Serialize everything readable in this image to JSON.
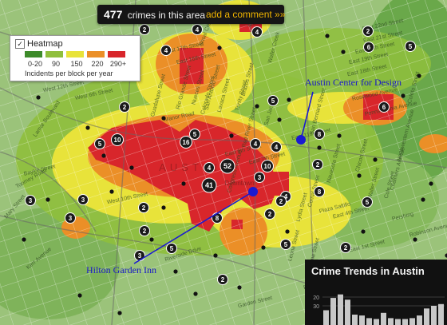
{
  "top_bar": {
    "count": "477",
    "count_label": "crimes in this area",
    "link": "add a comment »»"
  },
  "legend": {
    "checkbox_mark": "✓",
    "title": "Heatmap",
    "bins": [
      {
        "label": "0-20",
        "color": "#3d8b2a"
      },
      {
        "label": "90",
        "color": "#8fbf3c"
      },
      {
        "label": "150",
        "color": "#e8e33a"
      },
      {
        "label": "220",
        "color": "#eb8f27"
      },
      {
        "label": "290+",
        "color": "#d8262b"
      }
    ],
    "footnote": "Incidents per block per year"
  },
  "places": {
    "austin_center": "Austin Center for Design",
    "hilton": "Hilton Garden Inn",
    "city_label": "AUSTIN",
    "downtown": "Downtown"
  },
  "streets": [
    "East 22nd Street",
    "East 21st Street",
    "East 20th Street",
    "East 19th Street",
    "East 18th Street",
    "East 16th Street",
    "West 17th Street",
    "Manor Road",
    "Rosewood Avenue",
    "Pennsylvania Avenue",
    "East 11th Street",
    "East 6th Street",
    "West 6th Street",
    "Lamar Boulevard",
    "Guadalupe Street",
    "Colorado Street",
    "Congress Avenue",
    "Red River Street",
    "East 7th Street",
    "Navasota Street",
    "Chicon Street",
    "Comal Street",
    "East 4th Street",
    "Pershing",
    "Plaza Saltillo",
    "East 1st Street",
    "Garden Street",
    "Riverside Drive",
    "Rio Grande Street",
    "Nueces Street",
    "San Antonio Street",
    "Lavaca Street",
    "Trinity Street",
    "San Jacinto",
    "Brazos Street",
    "Waller Street",
    "Lydia Street",
    "Chalmers Avenue",
    "Northwestern Avenue",
    "Harvey Street",
    "Leona Street",
    "Salina Street",
    "Cole Street",
    "Coleto Street",
    "San Bernard Street",
    "Robinson Avenue",
    "Waller Creek",
    "Shoal Creek",
    "Kerr Avenue",
    "Mary Street",
    "Enfield Road",
    "Baylor Street",
    "Toomey Road",
    "Canterbury Street",
    "West 12th Street",
    "West 10th Street",
    "West Avenue",
    "East Cesar Chavez"
  ],
  "cluster_counts": [
    "10",
    "16",
    "52",
    "41",
    "10",
    "8",
    "4",
    "4",
    "4",
    "4",
    "4",
    "4",
    "4",
    "5",
    "5",
    "5",
    "5",
    "5",
    "5",
    "2",
    "2",
    "2",
    "2",
    "2",
    "2",
    "2",
    "2",
    "2",
    "2",
    "3",
    "3",
    "3",
    "3",
    "3",
    "6",
    "6",
    "8",
    "8",
    "5",
    "4"
  ],
  "trends": {
    "title": "Crime Trends in Austin",
    "y_ticks": [
      "30",
      "20"
    ],
    "chart_data": {
      "type": "bar",
      "title": "Crime Trends in Austin",
      "ylim": [
        0,
        30
      ],
      "yticks": [
        20,
        30
      ],
      "values": [
        15,
        29,
        33,
        27,
        10,
        9,
        6,
        5,
        12,
        6,
        5,
        5,
        6,
        9,
        17,
        20,
        22
      ]
    }
  },
  "colors": {
    "heat_red": "#d8262b",
    "heat_orange": "#eb8f27",
    "heat_yellow": "#e8e33a",
    "heat_lightgreen": "#8fbf3c",
    "heat_green": "#3d8b2a",
    "base_green": "#9bc37a",
    "marker_blue": "#1a1ad0",
    "label_blue": "#1818c8"
  }
}
